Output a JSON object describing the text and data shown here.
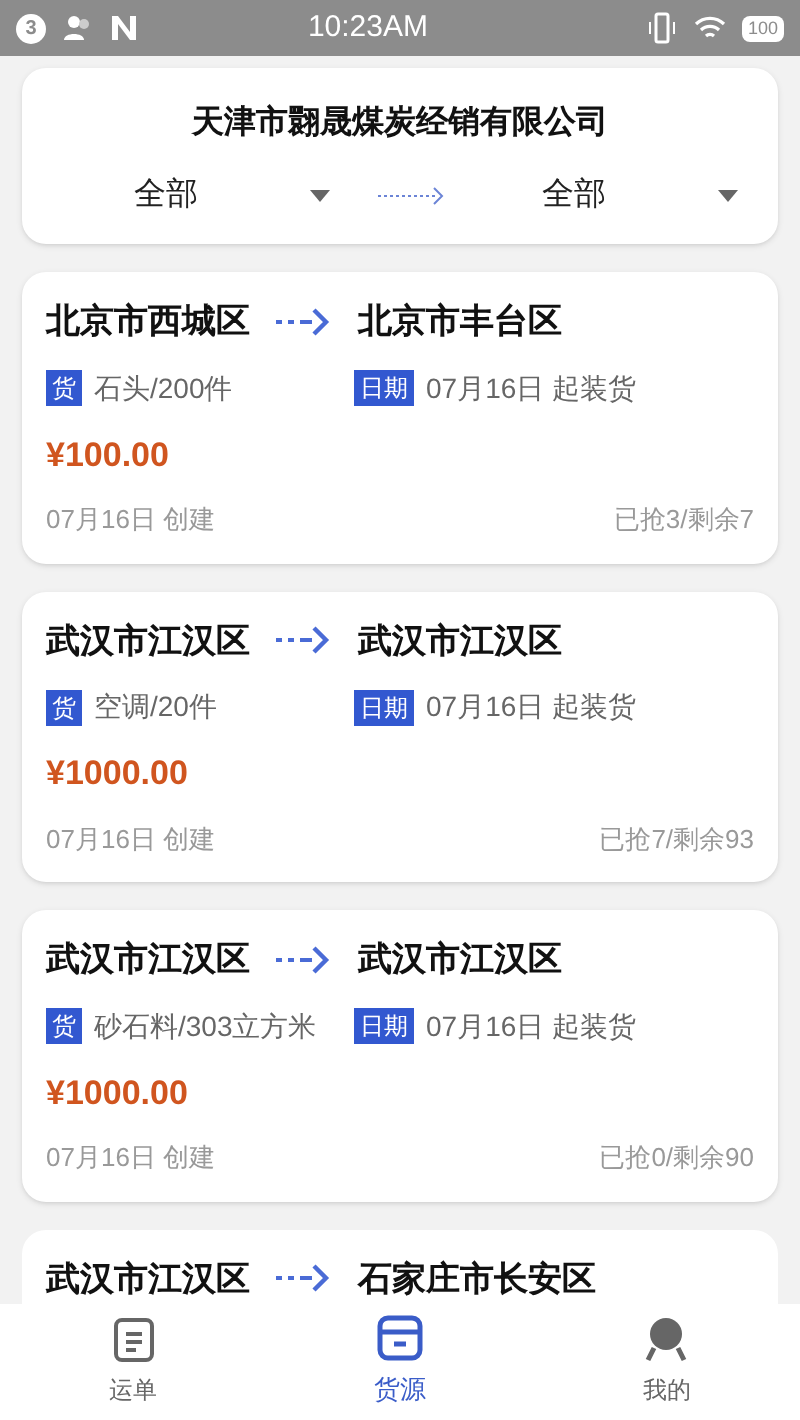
{
  "status_bar": {
    "notification_count": "3",
    "time": "10:23AM",
    "battery": "100"
  },
  "header": {
    "company": "天津市翾晟煤炭经销有限公司",
    "from_filter": "全部",
    "to_filter": "全部"
  },
  "orders": [
    {
      "from": "北京市西城区",
      "to": "北京市丰台区",
      "goods_tag": "货",
      "goods": "石头/200件",
      "date_tag": "日期",
      "date": "07月16日 起装货",
      "price": "¥100.00",
      "created": "07月16日 创建",
      "grabbed": "已抢3/剩余7"
    },
    {
      "from": "武汉市江汉区",
      "to": "武汉市江汉区",
      "goods_tag": "货",
      "goods": "空调/20件",
      "date_tag": "日期",
      "date": "07月16日 起装货",
      "price": "¥1000.00",
      "created": "07月16日 创建",
      "grabbed": "已抢7/剩余93"
    },
    {
      "from": "武汉市江汉区",
      "to": "武汉市江汉区",
      "goods_tag": "货",
      "goods": "砂石料/303立方米",
      "date_tag": "日期",
      "date": "07月16日 起装货",
      "price": "¥1000.00",
      "created": "07月16日 创建",
      "grabbed": "已抢0/剩余90"
    },
    {
      "from": "武汉市江汉区",
      "to": "石家庄市长安区"
    }
  ],
  "tabs": [
    {
      "kind": "orders",
      "label": "运单",
      "selected": false
    },
    {
      "kind": "cargo",
      "label": "货源",
      "selected": true
    },
    {
      "kind": "mine",
      "label": "我的",
      "selected": false
    }
  ]
}
